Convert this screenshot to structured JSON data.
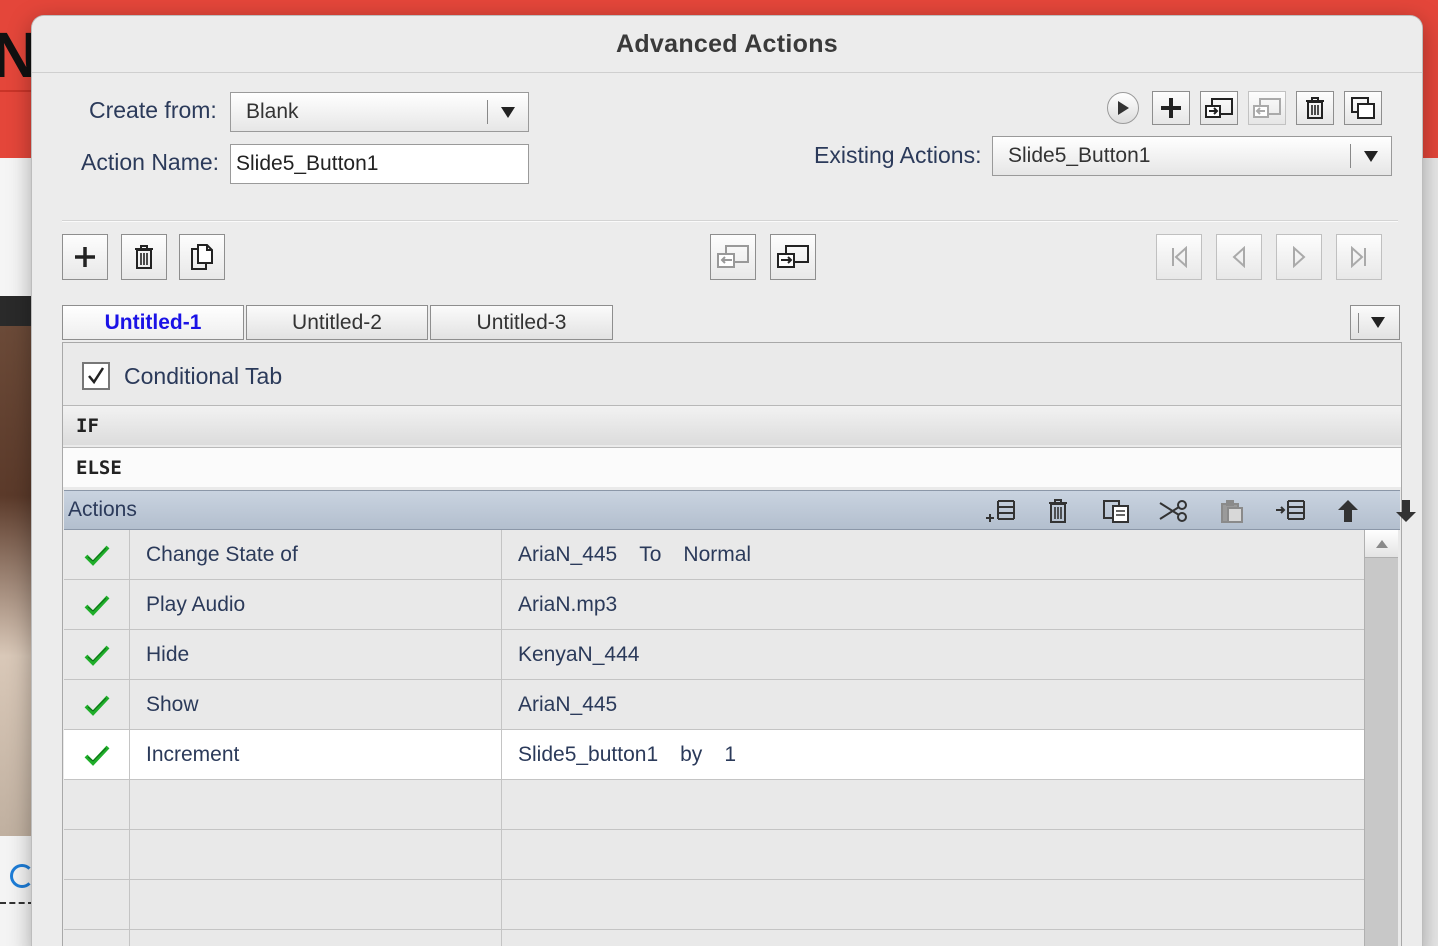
{
  "backdrop": {
    "letter": "N"
  },
  "dialog": {
    "title": "Advanced Actions"
  },
  "form": {
    "create_from_label": "Create from:",
    "create_from_value": "Blank",
    "action_name_label": "Action Name:",
    "action_name_value": "Slide5_Button1",
    "existing_actions_label": "Existing Actions:",
    "existing_actions_value": "Slide5_Button1"
  },
  "tabs": [
    {
      "label": "Untitled-1",
      "active": true
    },
    {
      "label": "Untitled-2",
      "active": false
    },
    {
      "label": "Untitled-3",
      "active": false
    }
  ],
  "conditional": {
    "label": "Conditional Tab",
    "checked": true
  },
  "sections": {
    "if_label": "IF",
    "else_label": "ELSE"
  },
  "actions": {
    "header": "Actions",
    "rows": [
      {
        "action": "Change State of",
        "params": [
          "AriaN_445",
          "To",
          "Normal"
        ]
      },
      {
        "action": "Play Audio",
        "params": [
          "AriaN.mp3"
        ]
      },
      {
        "action": "Hide",
        "params": [
          "KenyaN_444"
        ]
      },
      {
        "action": "Show",
        "params": [
          "AriaN_445"
        ]
      },
      {
        "action": "Increment",
        "params": [
          "Slide5_button1",
          "by",
          "1"
        ],
        "selected": true
      }
    ]
  },
  "colors": {
    "check": "#1fae2a",
    "active_tab": "#1a12e6",
    "header_bg": "#bfcad8"
  }
}
